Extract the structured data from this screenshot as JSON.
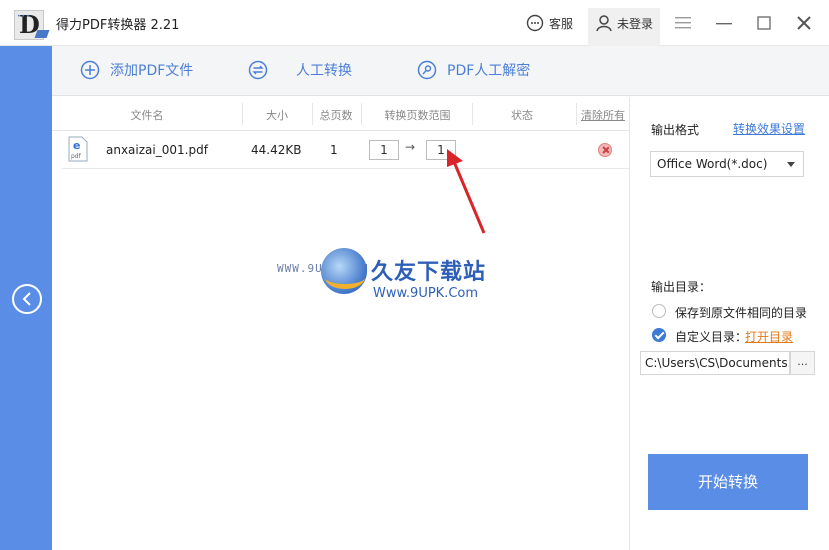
{
  "titlebar": {
    "title": "得力PDF转换器 2.21",
    "service_label": "客服",
    "login_label": "未登录"
  },
  "toolbar": {
    "add_pdf": "添加PDF文件",
    "manual_convert": "人工转换",
    "pdf_decrypt": "PDF人工解密"
  },
  "table": {
    "headers": {
      "filename": "文件名",
      "size": "大小",
      "pages": "总页数",
      "range": "转换页数范围",
      "status": "状态",
      "clear_all": "清除所有"
    },
    "rows": [
      {
        "filename": "anxaizai_001.pdf",
        "size": "44.42KB",
        "pages": "1",
        "range_from": "1",
        "range_to": "1",
        "status": ""
      }
    ],
    "file_icon_text": "pdf"
  },
  "watermark": {
    "left_text": "WWW.9UPK.COM",
    "main": "久友下载站",
    "sub": "Www.9UPK.Com"
  },
  "right_panel": {
    "output_format_label": "输出格式",
    "effect_settings_link": "转换效果设置",
    "format_value": "Office Word(*.doc)",
    "output_dir_label": "输出目录：",
    "same_dir_option": "保存到原文件相同的目录",
    "custom_dir_option": "自定义目录：",
    "open_dir_link": "打开目录",
    "path_value": "C:\\Users\\CS\\Documents...",
    "browse_label": "...",
    "start_button": "开始转换"
  },
  "colors": {
    "accent": "#5a8de6",
    "link": "#3d7ad6",
    "arrow": "#d9252a"
  }
}
